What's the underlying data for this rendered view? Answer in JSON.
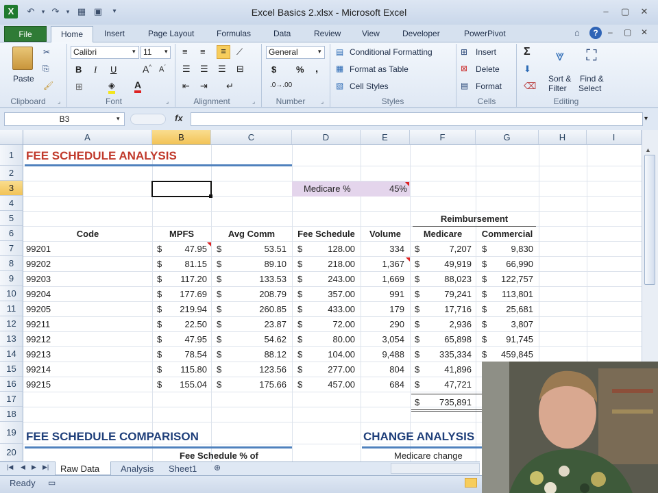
{
  "window": {
    "title": "Excel Basics 2.xlsx - Microsoft Excel"
  },
  "tabs": [
    "File",
    "Home",
    "Insert",
    "Page Layout",
    "Formulas",
    "Data",
    "Review",
    "View",
    "Developer",
    "PowerPivot"
  ],
  "ribbon": {
    "clipboard": {
      "paste": "Paste",
      "label": "Clipboard"
    },
    "font": {
      "name": "Calibri",
      "size": "11",
      "label": "Font"
    },
    "alignment": {
      "label": "Alignment"
    },
    "number": {
      "format": "General",
      "label": "Number",
      "currency": "$",
      "percent": "%",
      "comma": ","
    },
    "styles": {
      "conditional": "Conditional Formatting",
      "table": "Format as Table",
      "cell": "Cell Styles",
      "label": "Styles"
    },
    "cells": {
      "insert": "Insert",
      "delete": "Delete",
      "format": "Format",
      "label": "Cells"
    },
    "editing": {
      "sort1": "Sort &",
      "sort2": "Filter",
      "find1": "Find &",
      "find2": "Select",
      "label": "Editing",
      "sum": "Σ"
    }
  },
  "formula_bar": {
    "name_box": "B3",
    "fx": "fx",
    "value": ""
  },
  "columns": [
    "A",
    "B",
    "C",
    "D",
    "E",
    "F",
    "G",
    "H",
    "I"
  ],
  "rows": [
    "1",
    "2",
    "3",
    "4",
    "5",
    "6",
    "7",
    "8",
    "9",
    "10",
    "11",
    "12",
    "13",
    "14",
    "15",
    "16",
    "17",
    "18",
    "19",
    "20"
  ],
  "sheet": {
    "title1": "FEE SCHEDULE ANALYSIS",
    "medicare_label": "Medicare %",
    "medicare_value": "45%",
    "reimbursement": "Reimbursement",
    "headers": [
      "Code",
      "MPFS",
      "Avg Comm",
      "Fee Schedule",
      "Volume",
      "Medicare",
      "Commercial"
    ],
    "data": [
      {
        "code": "99201",
        "mpfs": "47.95",
        "avg": "53.51",
        "fee": "128.00",
        "vol": "334",
        "med": "7,207",
        "com": "9,830"
      },
      {
        "code": "99202",
        "mpfs": "81.15",
        "avg": "89.10",
        "fee": "218.00",
        "vol": "1,367",
        "med": "49,919",
        "com": "66,990"
      },
      {
        "code": "99203",
        "mpfs": "117.20",
        "avg": "133.53",
        "fee": "243.00",
        "vol": "1,669",
        "med": "88,023",
        "com": "122,757"
      },
      {
        "code": "99204",
        "mpfs": "177.69",
        "avg": "208.79",
        "fee": "357.00",
        "vol": "991",
        "med": "79,241",
        "com": "113,801"
      },
      {
        "code": "99205",
        "mpfs": "219.94",
        "avg": "260.85",
        "fee": "433.00",
        "vol": "179",
        "med": "17,716",
        "com": "25,681"
      },
      {
        "code": "99211",
        "mpfs": "22.50",
        "avg": "23.87",
        "fee": "72.00",
        "vol": "290",
        "med": "2,936",
        "com": "3,807"
      },
      {
        "code": "99212",
        "mpfs": "47.95",
        "avg": "54.62",
        "fee": "80.00",
        "vol": "3,054",
        "med": "65,898",
        "com": "91,745"
      },
      {
        "code": "99213",
        "mpfs": "78.54",
        "avg": "88.12",
        "fee": "104.00",
        "vol": "9,488",
        "med": "335,334",
        "com": "459,845"
      },
      {
        "code": "99214",
        "mpfs": "115.80",
        "avg": "123.56",
        "fee": "277.00",
        "vol": "804",
        "med": "41,896",
        "com": ""
      },
      {
        "code": "99215",
        "mpfs": "155.04",
        "avg": "175.66",
        "fee": "457.00",
        "vol": "684",
        "med": "47,721",
        "com": ""
      }
    ],
    "total_medicare": "735,891",
    "currency": "$",
    "title2": "FEE SCHEDULE COMPARISON",
    "title3": "CHANGE ANALYSIS",
    "sub2": "Fee Schedule % of",
    "sub3": "Medicare change"
  },
  "sheet_tabs": [
    "Raw Data",
    "Analysis",
    "Sheet1"
  ],
  "status": {
    "ready": "Ready"
  },
  "colors": {
    "title_red": "#c0392b",
    "title_blue": "#1f3f7a",
    "accent_green": "#2f7b36",
    "medicare_fill": "#e4d5ec"
  }
}
